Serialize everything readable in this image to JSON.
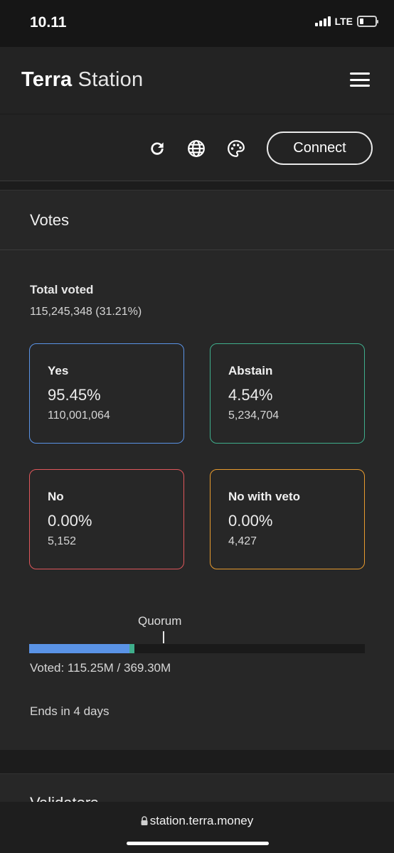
{
  "status_bar": {
    "time": "10.11",
    "network": "LTE"
  },
  "header": {
    "brand_bold": "Terra",
    "brand_light": "Station"
  },
  "toolbar": {
    "icons": [
      "refresh-icon",
      "globe-icon",
      "palette-icon",
      "menu-icon"
    ],
    "connect_label": "Connect"
  },
  "votes": {
    "title": "Votes",
    "total_label": "Total voted",
    "total_value": "115,245,348 (31.21%)",
    "options": [
      {
        "label": "Yes",
        "percent": "95.45%",
        "count": "110,001,064",
        "color": "#5a93e6"
      },
      {
        "label": "Abstain",
        "percent": "4.54%",
        "count": "5,234,704",
        "color": "#3fae8c"
      },
      {
        "label": "No",
        "percent": "0.00%",
        "count": "5,152",
        "color": "#e0575b"
      },
      {
        "label": "No with veto",
        "percent": "0.00%",
        "count": "4,427",
        "color": "#e89b2e"
      }
    ],
    "quorum_label": "Quorum",
    "voted_progress": {
      "voted_fraction": 0.3121,
      "yes_fraction": 0.2979,
      "abstain_fraction": 0.0142,
      "quorum_fraction": 0.4
    },
    "voted_text": "Voted: 115.25M / 369.30M",
    "ends_text": "Ends in 4 days"
  },
  "validators": {
    "title": "Validators"
  },
  "url_bar": {
    "url": "station.terra.money"
  }
}
